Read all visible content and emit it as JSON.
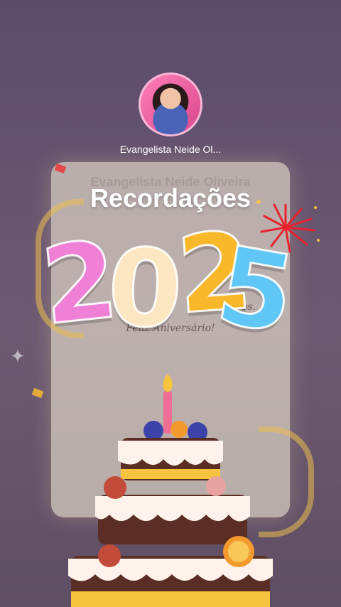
{
  "profile": {
    "username": "Evangelista Neide Ol..."
  },
  "background": {
    "ghost_name": "Evangelista Neide Oliveira",
    "ghost_text_1": "os.",
    "ghost_text_2": "Feliz Aniversário!"
  },
  "title": "Recordações",
  "year_digits": [
    "2",
    "0",
    "2",
    "5"
  ],
  "colors": {
    "title": "#ffffff",
    "digit_1": "#f07fd6",
    "digit_2": "#fde6c2",
    "digit_3": "#f9b72a",
    "digit_4": "#5fc6f5",
    "firework": "#e8232d"
  }
}
